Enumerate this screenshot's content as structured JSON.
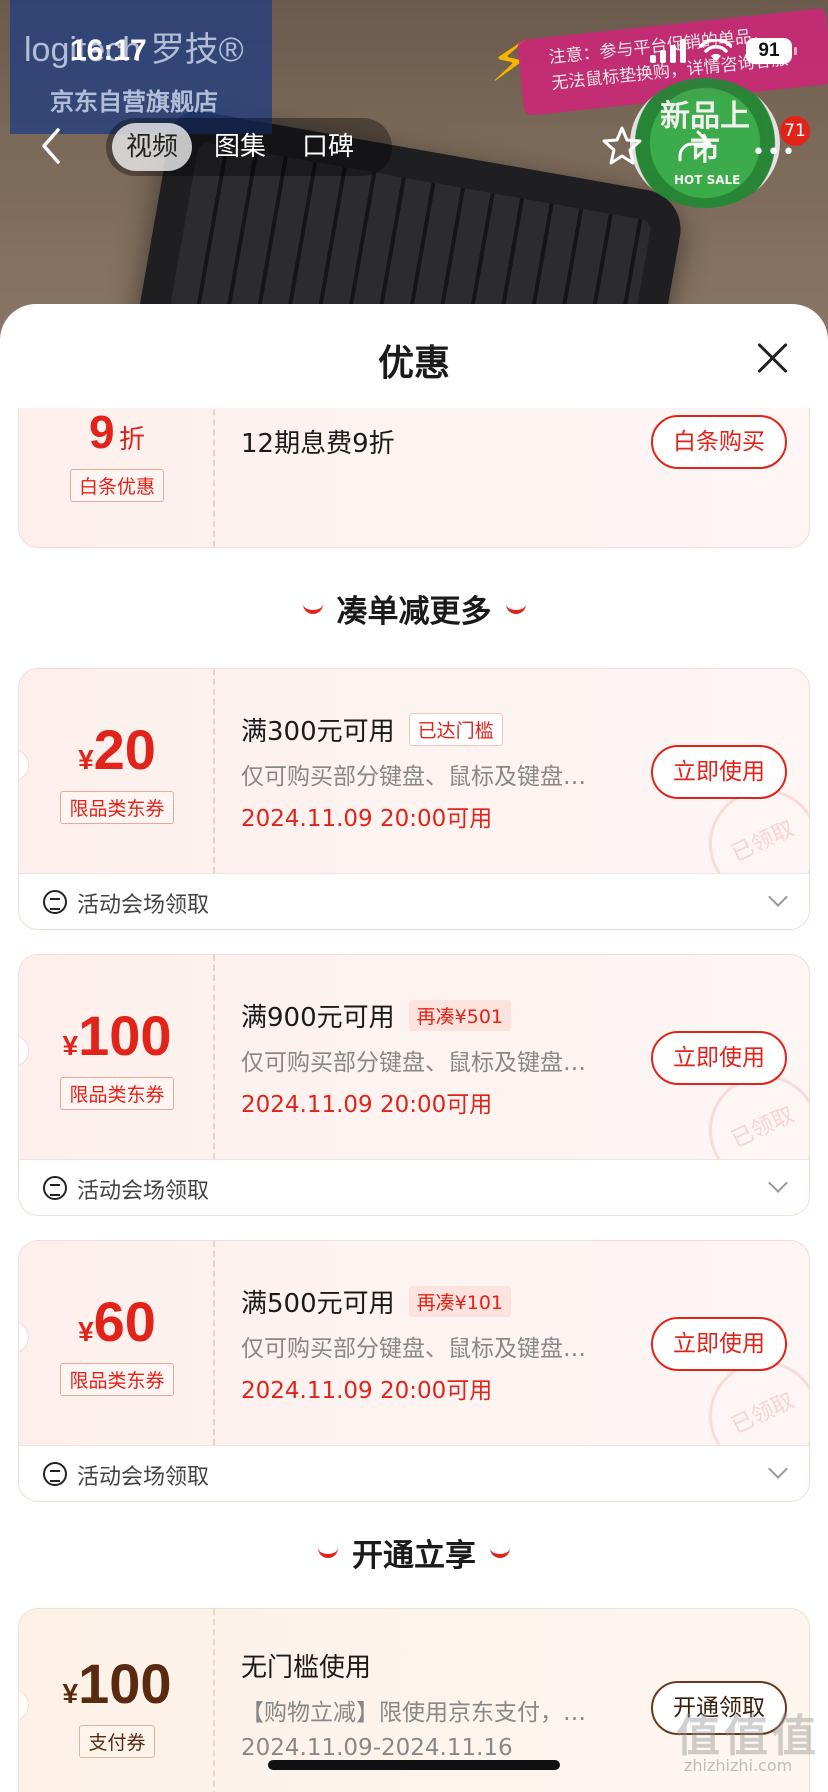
{
  "status": {
    "time": "16:17",
    "battery": "91"
  },
  "hero": {
    "brand_logo_text": "logitech 罗技®",
    "brand_store": "京东自营旗舰店",
    "notice_line1": "注意：参与平台促销的单品，",
    "notice_line2": "无法鼠标垫换购，详情咨询客服",
    "hot_sale_title": "新品上市",
    "hot_sale_sub": "HOT SALE"
  },
  "nav": {
    "tabs": [
      {
        "label": "视频",
        "active": true
      },
      {
        "label": "图集",
        "active": false
      },
      {
        "label": "口碑",
        "active": false
      }
    ],
    "message_count": "71"
  },
  "sheet": {
    "title": "优惠",
    "baitiao_card": {
      "discount_num": "9",
      "discount_unit": "折",
      "tag": "白条优惠",
      "title": "12期息费9折",
      "button": "白条购买"
    },
    "section1_title": "凑单减更多",
    "coupons": [
      {
        "yen": "¥",
        "amount": "20",
        "tag": "限品类东券",
        "title": "满300元可用",
        "badge": "已达门槛",
        "desc": "仅可购买部分键盘、鼠标及键盘…",
        "date": "2024.11.09 20:00可用",
        "button": "立即使用",
        "stamp": "已领取",
        "footer": "活动会场领取"
      },
      {
        "yen": "¥",
        "amount": "100",
        "tag": "限品类东券",
        "title": "满900元可用",
        "badge": "再凑¥501",
        "desc": "仅可购买部分键盘、鼠标及键盘…",
        "date": "2024.11.09 20:00可用",
        "button": "立即使用",
        "stamp": "已领取",
        "footer": "活动会场领取"
      },
      {
        "yen": "¥",
        "amount": "60",
        "tag": "限品类东券",
        "title": "满500元可用",
        "badge": "再凑¥101",
        "desc": "仅可购买部分键盘、鼠标及键盘…",
        "date": "2024.11.09 20:00可用",
        "button": "立即使用",
        "stamp": "已领取",
        "footer": "活动会场领取"
      }
    ],
    "section2_title": "开通立享",
    "pay_coupon": {
      "yen": "¥",
      "amount": "100",
      "tag": "支付券",
      "title": "无门槛使用",
      "desc": "【购物立减】限使用京东支付，…",
      "date": "2024.11.09-2024.11.16",
      "button": "开通领取"
    }
  },
  "watermark": {
    "main": "值值值",
    "sub": "zhizhizhi.com"
  },
  "colors": {
    "accent": "#e2231a",
    "card_bg": "#fdf0ec",
    "brown_accent": "#6b3a1c"
  }
}
